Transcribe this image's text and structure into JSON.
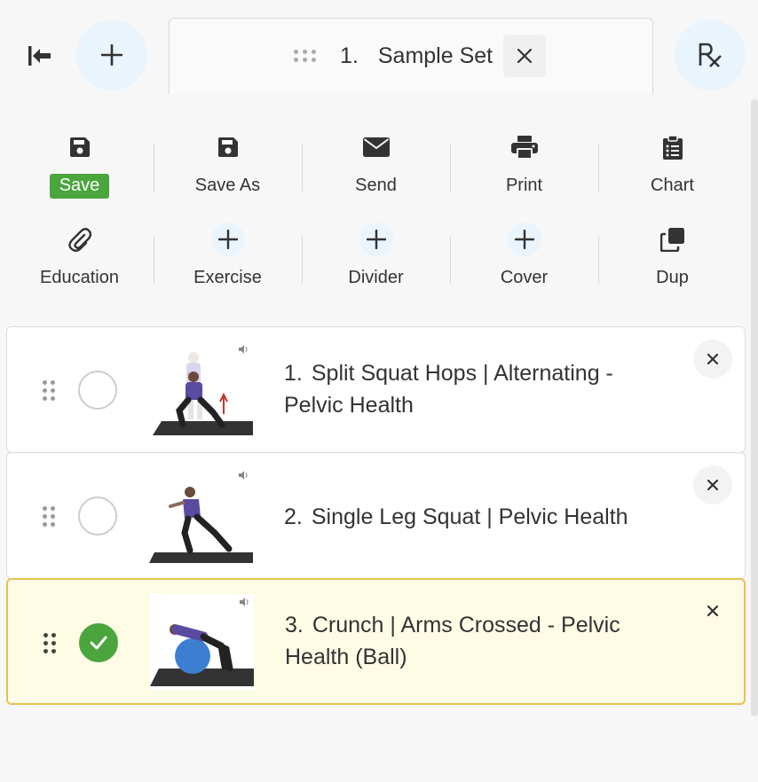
{
  "set_tab": {
    "number": "1.",
    "name": "Sample Set"
  },
  "toolbar": {
    "row1": [
      {
        "key": "save",
        "label": "Save",
        "icon": "floppy-disk-icon"
      },
      {
        "key": "save-as",
        "label": "Save As",
        "icon": "floppy-disk-icon"
      },
      {
        "key": "send",
        "label": "Send",
        "icon": "envelope-icon"
      },
      {
        "key": "print",
        "label": "Print",
        "icon": "printer-icon"
      },
      {
        "key": "chart",
        "label": "Chart",
        "icon": "clipboard-icon"
      }
    ],
    "row2": [
      {
        "key": "education",
        "label": "Education",
        "icon": "paperclip-icon"
      },
      {
        "key": "exercise",
        "label": "Exercise",
        "icon": "plus-icon"
      },
      {
        "key": "divider",
        "label": "Divider",
        "icon": "plus-icon"
      },
      {
        "key": "cover",
        "label": "Cover",
        "icon": "plus-icon"
      },
      {
        "key": "dup",
        "label": "Dup",
        "icon": "duplicate-icon"
      }
    ]
  },
  "exercises": [
    {
      "number": "1.",
      "title": "Split Squat Hops | Alternating - Pelvic Health",
      "selected": false
    },
    {
      "number": "2.",
      "title": "Single Leg Squat | Pelvic Health",
      "selected": false
    },
    {
      "number": "3.",
      "title": "Crunch | Arms Crossed - Pelvic Health (Ball)",
      "selected": true
    }
  ],
  "colors": {
    "accent_light": "#e9f4fd",
    "save_green": "#4aa53d",
    "selected_bg": "#fffce6",
    "selected_border": "#e7c24f"
  }
}
